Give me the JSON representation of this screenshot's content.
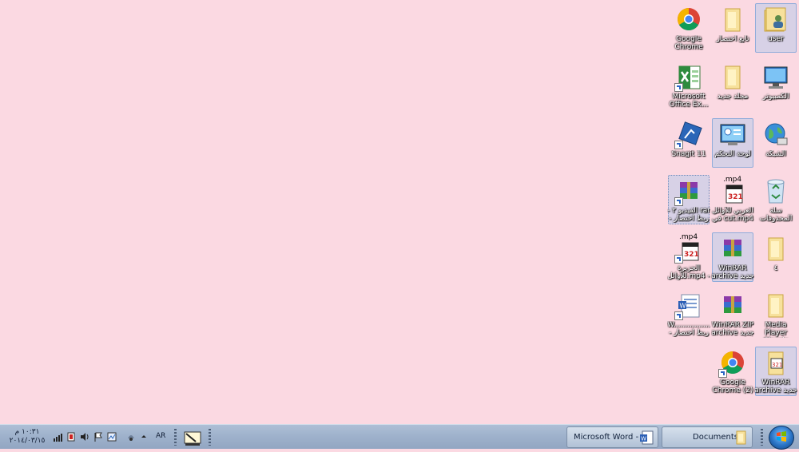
{
  "desktop": {
    "background_color": "#fbd9e2",
    "icons": {
      "user": "user",
      "shortcut_folder": "تابع اختصار",
      "chrome": "Google Chrome",
      "computer": "الكمبيوتر",
      "new_folder": "مجلد جديد",
      "excel": "Microsoft Office Ex...",
      "network": "الشبكة",
      "control_panel": "لوحة التحكم",
      "snagit": "Snagit 11",
      "recycle_bin": "سلة المحذوفات",
      "mp4_cut": "العربي للأوائل في cut.mp4",
      "rar_shortcut": "- الفيديو ۲ rar - ربط اختصار",
      "folder_4": "٤",
      "winrar_new_1": "WinRAR archive جديد",
      "mp4_shortcut": "الجزيرة للأوائل.mp4 -",
      "media_player": "Media Player Classic",
      "winrar_zip": "WinRAR ZIP archive جديد",
      "word_shortcut": "W................ - ربط اختصار",
      "winrar_new_2": "WinRAR archive جديد",
      "chrome_2": "Google Chrome (2)"
    },
    "mp4_badge": ".mp4",
    "mp4_badge_2": ".mp4"
  },
  "taskbar": {
    "clock_time": "١٠:٣١ م",
    "clock_date": "٢٠١٤/٠٣/١٥",
    "lang": "AR",
    "word_task": "Microsoft Word - ...",
    "documents_task": "Documents"
  }
}
